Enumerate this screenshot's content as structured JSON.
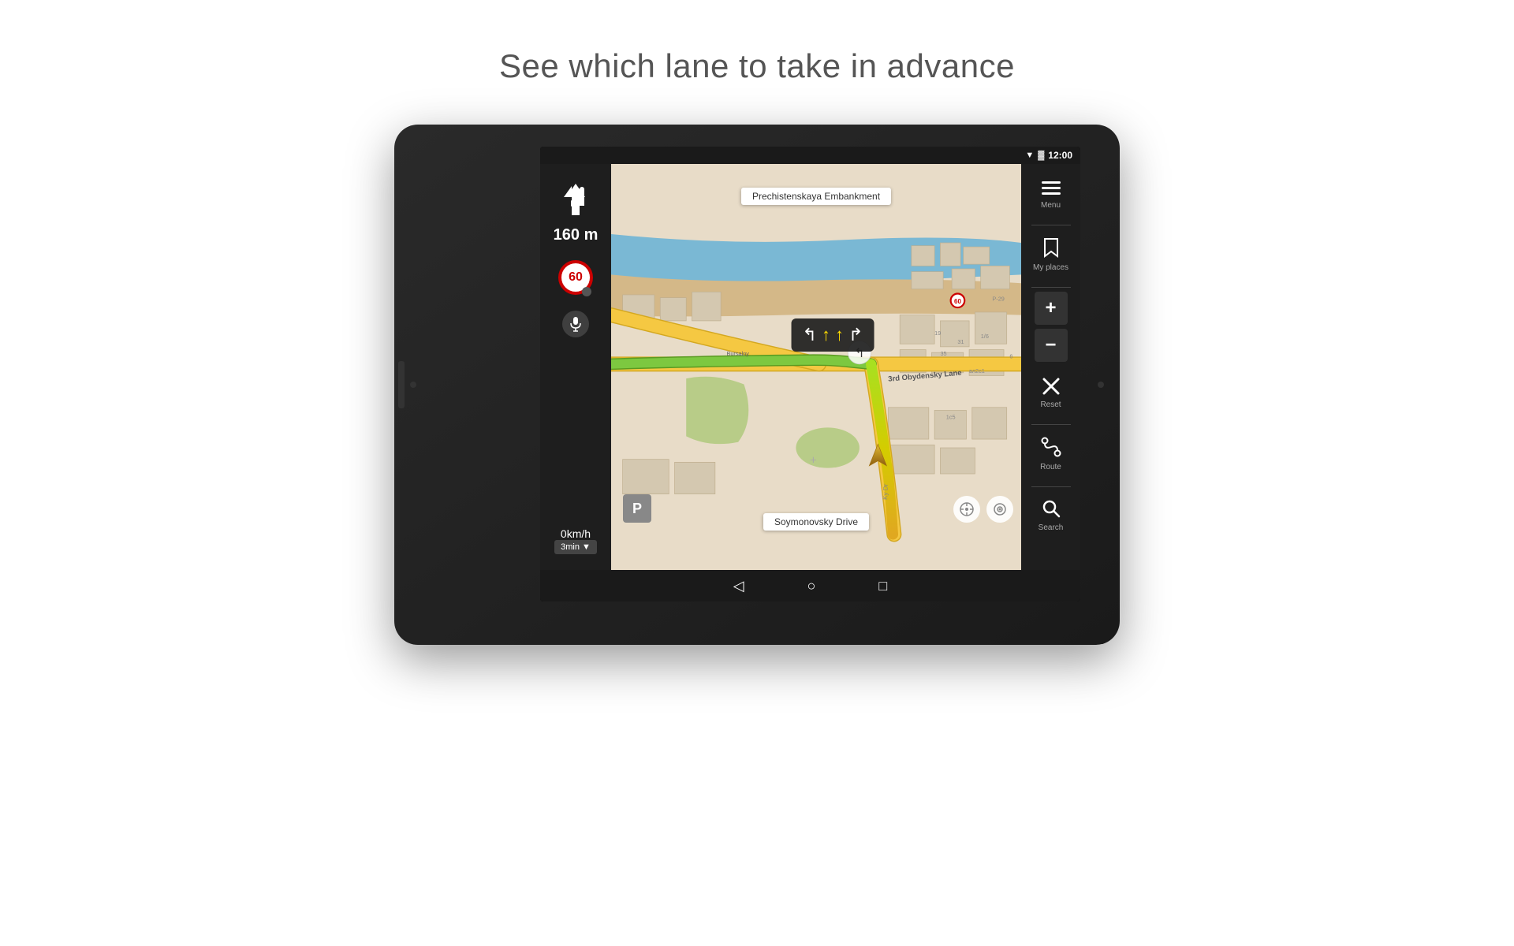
{
  "page": {
    "title": "See which lane to take in advance"
  },
  "status_bar": {
    "time": "12:00",
    "wifi": "▼",
    "battery": "🔋"
  },
  "navigation": {
    "turn_arrow": "↰",
    "turn_distance": "160 m",
    "speed_limit": "60",
    "speed_current": "0km/h",
    "time_remaining": "3min",
    "time_dropdown": "▼"
  },
  "map": {
    "street_top": "Prechistenskaya Embankment",
    "street_bottom": "Soymonovsky Drive",
    "label_3rd": "3rd Obydensky Lane"
  },
  "right_panel": {
    "menu_label": "Menu",
    "my_places_label": "My places",
    "reset_label": "Reset",
    "route_label": "Route",
    "search_label": "Search"
  },
  "system_bar": {
    "back": "◁",
    "home": "○",
    "recent": "□"
  },
  "lane_arrows": {
    "left": "↰",
    "straight1": "↑",
    "straight2": "↑",
    "right": "↱"
  },
  "map_controls": {
    "compass": "⊕",
    "locate": "◎"
  },
  "parking": "P"
}
